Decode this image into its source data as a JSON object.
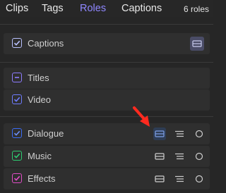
{
  "tabs": [
    {
      "label": "Clips",
      "active": false
    },
    {
      "label": "Tags",
      "active": false
    },
    {
      "label": "Roles",
      "active": true
    },
    {
      "label": "Captions",
      "active": false
    }
  ],
  "roles_count": "6 roles",
  "roles": {
    "captions": {
      "label": "Captions",
      "checked": true,
      "color": "#b9c1ff"
    },
    "titles": {
      "label": "Titles",
      "state": "mixed",
      "color": "#8e7cff"
    },
    "video": {
      "label": "Video",
      "checked": true,
      "color": "#6f7cff"
    },
    "dialogue": {
      "label": "Dialogue",
      "checked": true,
      "color": "#3b6cf6"
    },
    "music": {
      "label": "Music",
      "checked": true,
      "color": "#2ecc71"
    },
    "effects": {
      "label": "Effects",
      "checked": true,
      "color": "#e24cc8"
    }
  },
  "annotation": {
    "color": "#ff2a1f",
    "icon": "red-arrow-icon"
  }
}
